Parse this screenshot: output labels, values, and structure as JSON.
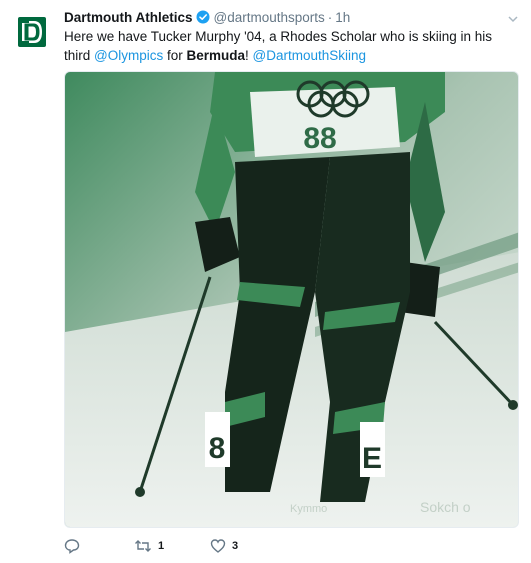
{
  "tweet": {
    "author_name": "Dartmouth Athletics",
    "handle": "@dartmouthsports",
    "separator": "·",
    "time": "1h",
    "avatar_letter": "D",
    "text_part1": "Here we have Tucker Murphy '04, a Rhodes Scholar who is skiing in his third ",
    "mention_olympics": "@Olympics",
    "text_part2": " for ",
    "bold_bermuda": "Bermuda",
    "text_part3": "! ",
    "mention_skiing": "@DartmouthSkiing"
  },
  "media": {
    "bib_number": "88",
    "leg_number_left": "8",
    "leg_number_right": "E",
    "sponsor_text": "Sokch o",
    "brand_text": "Kymmo"
  },
  "actions": {
    "reply_count": "",
    "retweet_count": "1",
    "like_count": "3"
  },
  "colors": {
    "brand_green": "#00693e",
    "link_blue": "#1b95e0",
    "muted": "#657786"
  }
}
